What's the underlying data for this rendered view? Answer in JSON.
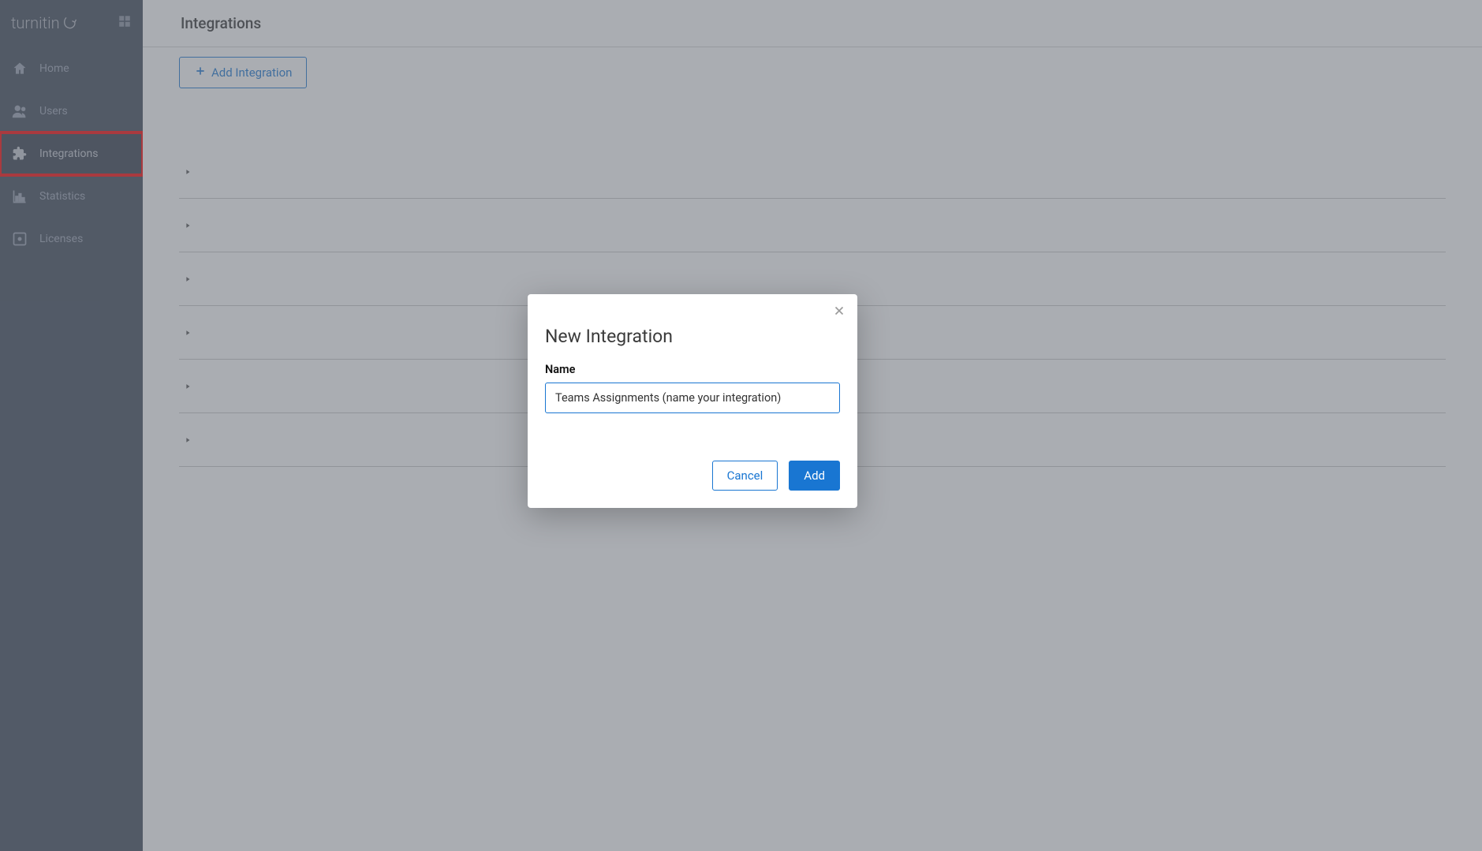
{
  "brand": {
    "name": "turnitin"
  },
  "sidebar": {
    "items": [
      {
        "label": "Home"
      },
      {
        "label": "Users"
      },
      {
        "label": "Integrations"
      },
      {
        "label": "Statistics"
      },
      {
        "label": "Licenses"
      }
    ]
  },
  "page": {
    "title": "Integrations",
    "add_button_label": "Add Integration"
  },
  "integration_rows_count": 6,
  "modal": {
    "title": "New Integration",
    "field_label": "Name",
    "input_value": "Teams Assignments (name your integration)",
    "cancel_label": "Cancel",
    "add_label": "Add"
  }
}
